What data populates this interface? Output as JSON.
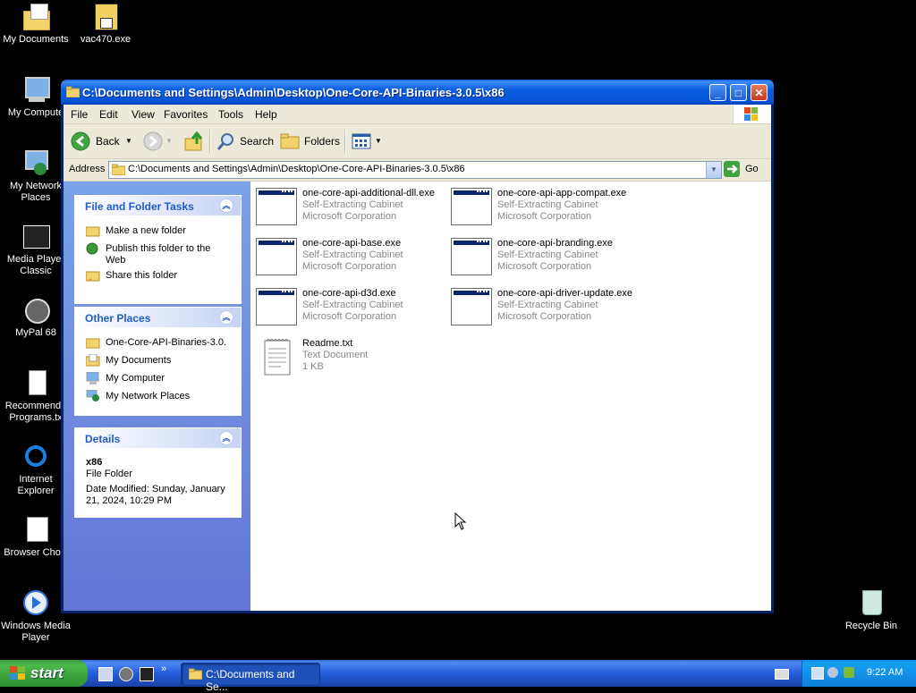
{
  "desktop": {
    "icons": [
      {
        "label": "My Documents"
      },
      {
        "label": "vac470.exe"
      },
      {
        "label": "My Compute"
      },
      {
        "label": "My Network Places"
      },
      {
        "label": "Media Player Classic"
      },
      {
        "label": "MyPal 68"
      },
      {
        "label": "Recommende Programs.tx"
      },
      {
        "label": "Internet Explorer"
      },
      {
        "label": "Browser Choic"
      },
      {
        "label": "Windows Media Player"
      },
      {
        "label": "Recycle Bin"
      }
    ]
  },
  "window": {
    "title": "C:\\Documents and Settings\\Admin\\Desktop\\One-Core-API-Binaries-3.0.5\\x86",
    "menu": [
      "File",
      "Edit",
      "View",
      "Favorites",
      "Tools",
      "Help"
    ],
    "toolbar": {
      "back": "Back",
      "search": "Search",
      "folders": "Folders"
    },
    "address": {
      "label": "Address",
      "value": "C:\\Documents and Settings\\Admin\\Desktop\\One-Core-API-Binaries-3.0.5\\x86",
      "go": "Go"
    },
    "tasks": {
      "title": "File and Folder Tasks",
      "items": [
        "Make a new folder",
        "Publish this folder to the Web",
        "Share this folder"
      ]
    },
    "other_places": {
      "title": "Other Places",
      "items": [
        "One-Core-API-Binaries-3.0.",
        "My Documents",
        "My Computer",
        "My Network Places"
      ]
    },
    "details": {
      "title": "Details",
      "name": "x86",
      "type": "File Folder",
      "modified": "Date Modified: Sunday, January 21, 2024, 10:29 PM"
    },
    "files": [
      {
        "name": "one-core-api-additional-dll.exe",
        "type": "Self-Extracting Cabinet",
        "company": "Microsoft Corporation"
      },
      {
        "name": "one-core-api-app-compat.exe",
        "type": "Self-Extracting Cabinet",
        "company": "Microsoft Corporation"
      },
      {
        "name": "one-core-api-base.exe",
        "type": "Self-Extracting Cabinet",
        "company": "Microsoft Corporation"
      },
      {
        "name": "one-core-api-branding.exe",
        "type": "Self-Extracting Cabinet",
        "company": "Microsoft Corporation"
      },
      {
        "name": "one-core-api-d3d.exe",
        "type": "Self-Extracting Cabinet",
        "company": "Microsoft Corporation"
      },
      {
        "name": "one-core-api-driver-update.exe",
        "type": "Self-Extracting Cabinet",
        "company": "Microsoft Corporation"
      },
      {
        "name": "Readme.txt",
        "type": "Text Document",
        "company": "1 KB"
      }
    ]
  },
  "taskbar": {
    "start": "start",
    "task": "C:\\Documents and Se...",
    "clock": "9:22 AM"
  },
  "colors": {
    "titlebar": "#0554d6",
    "leftpane": "#6375d6",
    "panel_heading": "#215dc6",
    "start_green": "#3c9a3c"
  }
}
